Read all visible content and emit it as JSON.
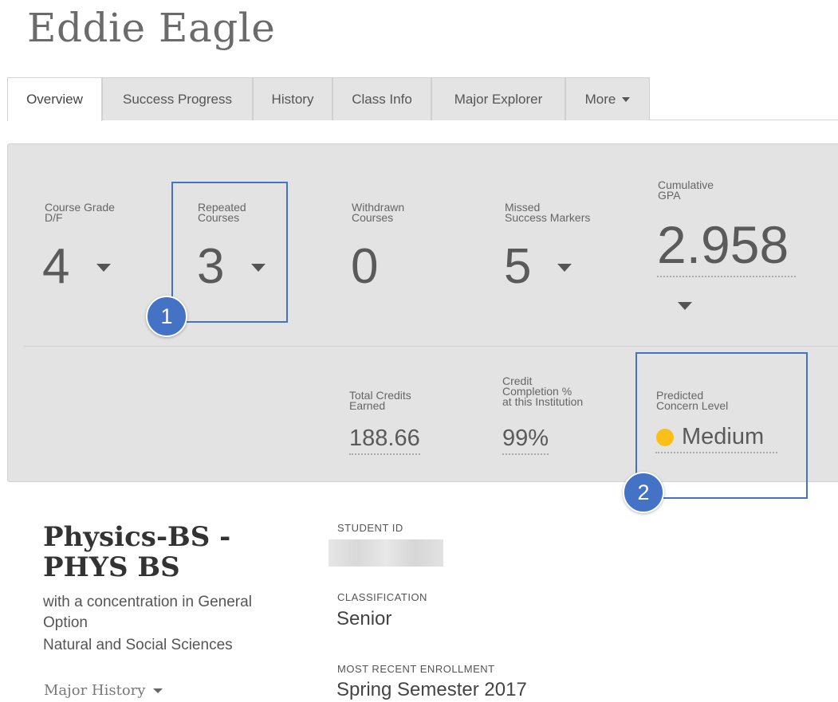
{
  "student": {
    "name": "Eddie Eagle"
  },
  "tabs": [
    {
      "label": "Overview",
      "active": true
    },
    {
      "label": "Success Progress"
    },
    {
      "label": "History"
    },
    {
      "label": "Class Info"
    },
    {
      "label": "Major Explorer"
    },
    {
      "label": "More"
    }
  ],
  "metrics": {
    "grade_df": {
      "label": "Course Grade\nD/F",
      "value": "4"
    },
    "repeated": {
      "label": "Repeated\nCourses",
      "value": "3"
    },
    "withdrawn": {
      "label": "Withdrawn\nCourses",
      "value": "0"
    },
    "missed": {
      "label": "Missed\nSuccess Markers",
      "value": "5"
    },
    "gpa": {
      "label": "Cumulative\nGPA",
      "value": "2.958"
    },
    "credits": {
      "label": "Total Credits\nEarned",
      "value": "188.66"
    },
    "completion": {
      "label": "Credit\nCompletion %\nat this Institution",
      "value": "99%"
    },
    "concern": {
      "label": "Predicted\nConcern Level",
      "value": "Medium",
      "color": "#fbbf1a"
    }
  },
  "callouts": {
    "one": "1",
    "two": "2",
    "color": "#4472c4"
  },
  "major": {
    "title": "Physics-BS - PHYS BS",
    "concentration": "with a concentration in General Option",
    "college": "Natural and Social Sciences",
    "history_label": "Major History"
  },
  "info": {
    "student_id_label": "STUDENT ID",
    "classification_label": "CLASSIFICATION",
    "classification_value": "Senior",
    "enrollment_label": "MOST RECENT ENROLLMENT",
    "enrollment_value": "Spring Semester 2017"
  }
}
